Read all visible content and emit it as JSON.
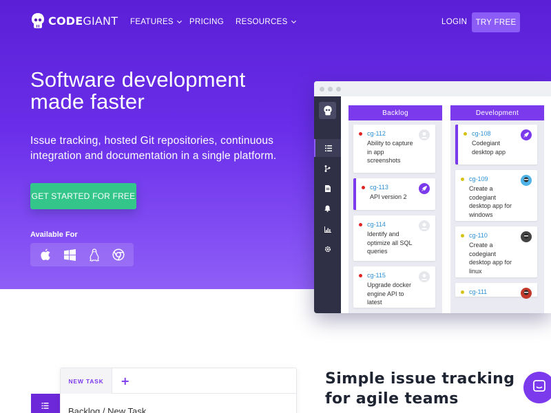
{
  "nav": {
    "logo_code": "CODE",
    "logo_giant": "GIANT",
    "features": "FEATURES",
    "pricing": "PRICING",
    "resources": "RESOURCES",
    "login": "LOGIN",
    "try_free": "TRY FREE"
  },
  "hero": {
    "headline": "Software development made faster",
    "subline": "Issue tracking, hosted Git repositories, continuous integration and documentation in a single platform.",
    "cta": "GET STARTED FOR FREE",
    "available_for": "Available For",
    "platforms": [
      "apple-icon",
      "windows-icon",
      "linux-icon",
      "chrome-icon"
    ]
  },
  "mockup": {
    "sidebar_icons": [
      "list-icon",
      "git-branch-icon",
      "document-icon",
      "bell-icon",
      "chart-icon",
      "gear-icon"
    ],
    "columns": [
      {
        "title": "Backlog",
        "cards": [
          {
            "id": "cg-112",
            "text": "Ability to capture in app screenshots",
            "status_color": "#e02424",
            "avatar": "placeholder"
          },
          {
            "id": "cg-113",
            "text": "API version 2",
            "status_color": "#e02424",
            "avatar": "rocket",
            "flag": true
          },
          {
            "id": "cg-114",
            "text": "Identify and optimize all SQL queries",
            "status_color": "#e02424",
            "avatar": "placeholder"
          },
          {
            "id": "cg-115",
            "text": "Upgrade docker engine API to latest",
            "status_color": "#e02424",
            "avatar": "placeholder"
          }
        ]
      },
      {
        "title": "Development",
        "cards": [
          {
            "id": "cg-108",
            "text": "Codegiant desktop app",
            "status_color": "#d4c20f",
            "avatar": "rocket",
            "flag": true
          },
          {
            "id": "cg-109",
            "text": "Create a codegiant desktop app for windows",
            "status_color": "#d4c20f",
            "avatar": "user-blue"
          },
          {
            "id": "cg-110",
            "text": "Create a codegiant desktop app for linux",
            "status_color": "#d4c20f",
            "avatar": "user-dark"
          },
          {
            "id": "cg-111",
            "text": "",
            "status_color": "#d4c20f",
            "avatar": "user-red"
          }
        ]
      }
    ]
  },
  "lower": {
    "tab_new_task": "NEW TASK",
    "plus": "+",
    "crumb": "Backlog / New Task",
    "section_title": "Simple issue tracking for agile teams"
  },
  "colors": {
    "brand_purple": "#7c3aed",
    "cta_green": "#34c58a",
    "link_blue": "#2b8fd6"
  }
}
